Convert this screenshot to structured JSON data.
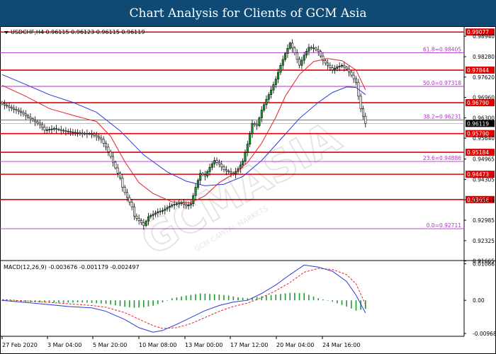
{
  "header": {
    "title": "Chart Analysis for Clients of GCM Asia"
  },
  "watermark": {
    "text": "GCMASIA",
    "sub_text": "GCM CAPITAL MARKETS"
  },
  "colors": {
    "title_bg": "#0e4a73",
    "candle": "#000000",
    "bull_fill": "#17a02e",
    "bear_fill": "#ffffff",
    "ma_fast": "#e8202a",
    "ma_slow": "#2a3bd8",
    "resistance_line": "#e00000",
    "fib_line": "#b030c8",
    "macd_line": "#2a3bd8",
    "signal_line": "#e8202a",
    "histogram": "#1f9b2e"
  },
  "chart_data": [
    {
      "type": "candlestick",
      "symbol_info": "USDCHF,H4  0.96115 0.96123 0.96115 0.96119",
      "ylim": [
        0.9168,
        0.9922
      ],
      "y_ticks": [
        "0.98940",
        "0.98280",
        "0.97620",
        "0.96960",
        "0.96300",
        "0.95640",
        "0.94965",
        "0.94305",
        "0.93645",
        "0.92985",
        "0.92325",
        "0.91665"
      ],
      "x_ticks": [
        "27 Feb 2020",
        "3 Mar 04:00",
        "5 Mar 20:00",
        "10 Mar 08:00",
        "13 Mar 00:00",
        "17 Mar 12:00",
        "20 Mar 04:00",
        "24 Mar 16:00"
      ],
      "current_price": "0.96119",
      "horizontal_levels": [
        {
          "value": 0.99077,
          "label": "0.99077"
        },
        {
          "value": 0.97844,
          "label": "0.97844"
        },
        {
          "value": 0.9679,
          "label": "0.96790"
        },
        {
          "value": 0.9579,
          "label": "0.95790"
        },
        {
          "value": 0.95184,
          "label": "0.95184"
        },
        {
          "value": 0.94473,
          "label": "0.94473"
        },
        {
          "value": 0.93656,
          "label": "0.93656"
        }
      ],
      "fibonacci_levels": [
        {
          "value": 0.98405,
          "label": "61.8=0.98405"
        },
        {
          "value": 0.97318,
          "label": "50.0=0.97318"
        },
        {
          "value": 0.96231,
          "label": "38.2=0.96231"
        },
        {
          "value": 0.94886,
          "label": "23.6=0.94886"
        },
        {
          "value": 0.92711,
          "label": "0.0=0.92711"
        }
      ],
      "close_path": [
        [
          0,
          0.9675
        ],
        [
          4,
          0.9661
        ],
        [
          8,
          0.9648
        ],
        [
          12,
          0.9627
        ],
        [
          16,
          0.9608
        ],
        [
          18,
          0.959
        ],
        [
          22,
          0.9595
        ],
        [
          26,
          0.9588
        ],
        [
          30,
          0.9583
        ],
        [
          34,
          0.958
        ],
        [
          38,
          0.9578
        ],
        [
          42,
          0.956
        ],
        [
          44,
          0.9535
        ],
        [
          46,
          0.9505
        ],
        [
          48,
          0.9468
        ],
        [
          50,
          0.9435
        ],
        [
          51,
          0.9405
        ],
        [
          53,
          0.9372
        ],
        [
          55,
          0.9342
        ],
        [
          56,
          0.9312
        ],
        [
          58,
          0.9298
        ],
        [
          60,
          0.9282
        ],
        [
          62,
          0.931
        ],
        [
          64,
          0.9318
        ],
        [
          66,
          0.9326
        ],
        [
          68,
          0.933
        ],
        [
          70,
          0.934
        ],
        [
          72,
          0.9348
        ],
        [
          74,
          0.9352
        ],
        [
          76,
          0.9355
        ],
        [
          78,
          0.9345
        ],
        [
          80,
          0.9352
        ],
        [
          82,
          0.9405
        ],
        [
          84,
          0.945
        ],
        [
          86,
          0.9442
        ],
        [
          88,
          0.947
        ],
        [
          90,
          0.9492
        ],
        [
          92,
          0.948
        ],
        [
          94,
          0.9462
        ],
        [
          96,
          0.9455
        ],
        [
          98,
          0.9448
        ],
        [
          100,
          0.9465
        ],
        [
          102,
          0.949
        ],
        [
          104,
          0.9545
        ],
        [
          106,
          0.9612
        ],
        [
          108,
          0.9605
        ],
        [
          110,
          0.9655
        ],
        [
          112,
          0.969
        ],
        [
          114,
          0.972
        ],
        [
          116,
          0.9755
        ],
        [
          118,
          0.98
        ],
        [
          120,
          0.9838
        ],
        [
          122,
          0.9872
        ],
        [
          124,
          0.984
        ],
        [
          126,
          0.98
        ],
        [
          128,
          0.9833
        ],
        [
          130,
          0.9858
        ],
        [
          132,
          0.9856
        ],
        [
          134,
          0.9845
        ],
        [
          136,
          0.9815
        ],
        [
          138,
          0.98
        ],
        [
          140,
          0.9785
        ],
        [
          142,
          0.9795
        ],
        [
          144,
          0.98
        ],
        [
          146,
          0.9788
        ],
        [
          148,
          0.9768
        ],
        [
          150,
          0.9745
        ],
        [
          151,
          0.97
        ],
        [
          152,
          0.966
        ],
        [
          153,
          0.9635
        ],
        [
          154,
          0.9612
        ]
      ],
      "ma_fast_path": [
        [
          0,
          0.9735
        ],
        [
          10,
          0.97
        ],
        [
          20,
          0.966
        ],
        [
          30,
          0.9638
        ],
        [
          40,
          0.9618
        ],
        [
          46,
          0.957
        ],
        [
          52,
          0.9488
        ],
        [
          58,
          0.942
        ],
        [
          64,
          0.9385
        ],
        [
          72,
          0.9358
        ],
        [
          80,
          0.9355
        ],
        [
          86,
          0.9378
        ],
        [
          92,
          0.942
        ],
        [
          98,
          0.9448
        ],
        [
          104,
          0.9485
        ],
        [
          110,
          0.9548
        ],
        [
          116,
          0.9632
        ],
        [
          120,
          0.97
        ],
        [
          126,
          0.977
        ],
        [
          132,
          0.9812
        ],
        [
          138,
          0.9822
        ],
        [
          144,
          0.9815
        ],
        [
          150,
          0.9785
        ],
        [
          154,
          0.972
        ]
      ],
      "ma_slow_path": [
        [
          0,
          0.977
        ],
        [
          10,
          0.9738
        ],
        [
          20,
          0.9705
        ],
        [
          30,
          0.968
        ],
        [
          40,
          0.9648
        ],
        [
          50,
          0.9588
        ],
        [
          60,
          0.951
        ],
        [
          70,
          0.9455
        ],
        [
          78,
          0.9425
        ],
        [
          86,
          0.941
        ],
        [
          94,
          0.9415
        ],
        [
          102,
          0.944
        ],
        [
          110,
          0.9492
        ],
        [
          118,
          0.956
        ],
        [
          126,
          0.9628
        ],
        [
          134,
          0.968
        ],
        [
          140,
          0.9712
        ],
        [
          146,
          0.973
        ],
        [
          150,
          0.9728
        ],
        [
          154,
          0.9705
        ]
      ]
    },
    {
      "type": "macd",
      "label": "MACD(12,26,9) -0.003676 -0.001179 -0.002497",
      "y_ticks": [
        "0.010667",
        "0.00",
        "-0.009681"
      ],
      "ylim": [
        -0.0105,
        0.0112
      ],
      "macd_path": [
        [
          0,
          0.0
        ],
        [
          16,
          -0.001
        ],
        [
          28,
          -0.0018
        ],
        [
          38,
          -0.0022
        ],
        [
          44,
          -0.0032
        ],
        [
          52,
          -0.0056
        ],
        [
          58,
          -0.008
        ],
        [
          64,
          -0.0093
        ],
        [
          68,
          -0.0088
        ],
        [
          74,
          -0.007
        ],
        [
          80,
          -0.005
        ],
        [
          86,
          -0.003
        ],
        [
          92,
          -0.0015
        ],
        [
          98,
          -0.0005
        ],
        [
          104,
          0.0
        ],
        [
          110,
          0.002
        ],
        [
          116,
          0.0045
        ],
        [
          122,
          0.0075
        ],
        [
          128,
          0.0103
        ],
        [
          134,
          0.0097
        ],
        [
          140,
          0.0085
        ],
        [
          146,
          0.0055
        ],
        [
          150,
          0.0015
        ],
        [
          154,
          -0.0037
        ]
      ],
      "signal_path": [
        [
          0,
          0.0002
        ],
        [
          16,
          -0.0004
        ],
        [
          28,
          -0.001
        ],
        [
          38,
          -0.0015
        ],
        [
          44,
          -0.002
        ],
        [
          52,
          -0.0036
        ],
        [
          58,
          -0.0055
        ],
        [
          64,
          -0.0074
        ],
        [
          68,
          -0.0082
        ],
        [
          74,
          -0.008
        ],
        [
          80,
          -0.0068
        ],
        [
          86,
          -0.005
        ],
        [
          92,
          -0.0032
        ],
        [
          98,
          -0.0018
        ],
        [
          104,
          -0.0008
        ],
        [
          110,
          0.0008
        ],
        [
          116,
          0.0028
        ],
        [
          122,
          0.0052
        ],
        [
          128,
          0.0082
        ],
        [
          134,
          0.0093
        ],
        [
          140,
          0.009
        ],
        [
          146,
          0.0075
        ],
        [
          150,
          0.0048
        ],
        [
          154,
          -0.0012
        ]
      ],
      "hist_samples": [
        [
          0,
          -0.0002
        ],
        [
          12,
          -0.0005
        ],
        [
          24,
          -0.0007
        ],
        [
          34,
          -0.0006
        ],
        [
          44,
          -0.001
        ],
        [
          50,
          -0.0017
        ],
        [
          56,
          -0.0022
        ],
        [
          60,
          -0.002
        ],
        [
          64,
          -0.0016
        ],
        [
          68,
          -0.0006
        ],
        [
          72,
          0.0006
        ],
        [
          78,
          0.0014
        ],
        [
          84,
          0.002
        ],
        [
          90,
          0.0018
        ],
        [
          96,
          0.0014
        ],
        [
          100,
          0.0009
        ],
        [
          104,
          0.0006
        ],
        [
          110,
          0.0012
        ],
        [
          116,
          0.0017
        ],
        [
          122,
          0.0022
        ],
        [
          128,
          0.0021
        ],
        [
          134,
          0.0006
        ],
        [
          140,
          -0.0004
        ],
        [
          146,
          -0.0018
        ],
        [
          150,
          -0.003
        ],
        [
          154,
          -0.0025
        ]
      ]
    }
  ]
}
